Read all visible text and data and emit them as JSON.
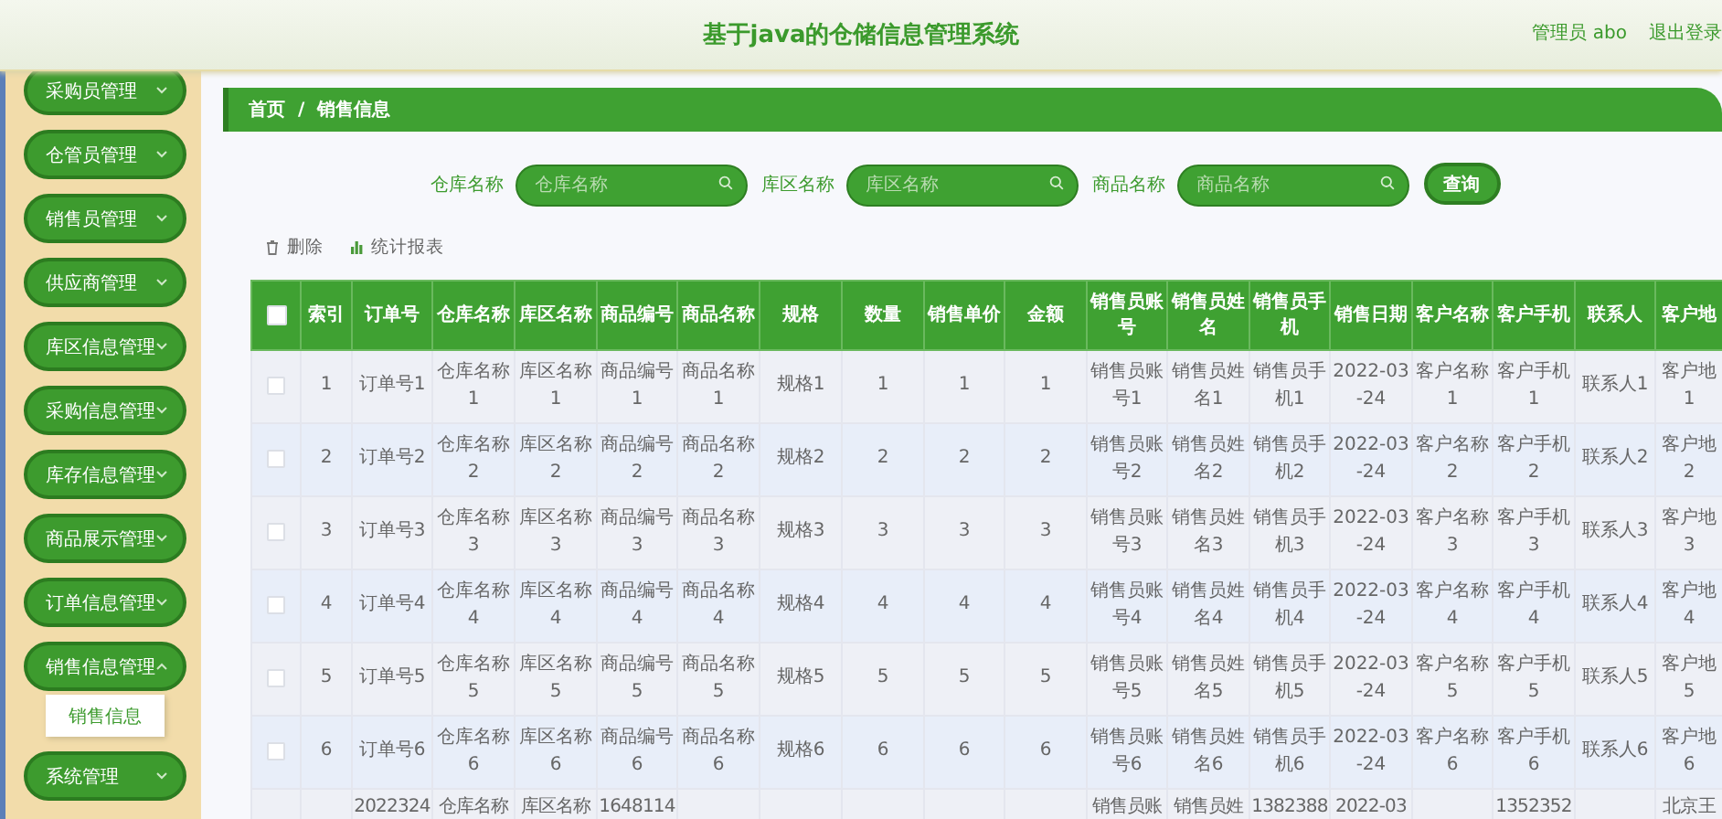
{
  "header": {
    "title": "基于java的仓储信息管理系统",
    "user": "管理员 abo",
    "logout": "退出登录"
  },
  "sidebar": {
    "items": [
      {
        "label": "采购员管理",
        "expanded": false
      },
      {
        "label": "仓管员管理",
        "expanded": false
      },
      {
        "label": "销售员管理",
        "expanded": false
      },
      {
        "label": "供应商管理",
        "expanded": false
      },
      {
        "label": "库区信息管理",
        "expanded": false
      },
      {
        "label": "采购信息管理",
        "expanded": false
      },
      {
        "label": "库存信息管理",
        "expanded": false
      },
      {
        "label": "商品展示管理",
        "expanded": false
      },
      {
        "label": "订单信息管理",
        "expanded": false
      },
      {
        "label": "销售信息管理",
        "expanded": true,
        "children": [
          {
            "label": "销售信息",
            "selected": true
          }
        ]
      },
      {
        "label": "系统管理",
        "expanded": false
      }
    ]
  },
  "breadcrumb": {
    "items": [
      "首页",
      "销售信息"
    ],
    "separator": "/"
  },
  "search": {
    "fields": [
      {
        "label": "仓库名称",
        "placeholder": "仓库名称"
      },
      {
        "label": "库区名称",
        "placeholder": "库区名称"
      },
      {
        "label": "商品名称",
        "placeholder": "商品名称"
      }
    ],
    "button": "查询"
  },
  "actions": [
    {
      "kind": "delete",
      "label": "删除"
    },
    {
      "kind": "chart",
      "label": "统计报表"
    }
  ],
  "table": {
    "all_checked": false,
    "columns": [
      "索引",
      "订单号",
      "仓库名称",
      "库区名称",
      "商品编号",
      "商品名称",
      "规格",
      "数量",
      "销售单价",
      "金额",
      "销售员账号",
      "销售员姓名",
      "销售员手机",
      "销售日期",
      "客户名称",
      "客户手机",
      "联系人",
      "客户地"
    ],
    "rows": [
      {
        "checked": false,
        "cells": [
          "1",
          "订单号1",
          "仓库名称1",
          "库区名称1",
          "商品编号1",
          "商品名称1",
          "规格1",
          "1",
          "1",
          "1",
          "销售员账号1",
          "销售员姓名1",
          "销售员手机1",
          "2022-03-24",
          "客户名称1",
          "客户手机1",
          "联系人1",
          "客户地1"
        ]
      },
      {
        "checked": false,
        "cells": [
          "2",
          "订单号2",
          "仓库名称2",
          "库区名称2",
          "商品编号2",
          "商品名称2",
          "规格2",
          "2",
          "2",
          "2",
          "销售员账号2",
          "销售员姓名2",
          "销售员手机2",
          "2022-03-24",
          "客户名称2",
          "客户手机2",
          "联系人2",
          "客户地2"
        ]
      },
      {
        "checked": false,
        "cells": [
          "3",
          "订单号3",
          "仓库名称3",
          "库区名称3",
          "商品编号3",
          "商品名称3",
          "规格3",
          "3",
          "3",
          "3",
          "销售员账号3",
          "销售员姓名3",
          "销售员手机3",
          "2022-03-24",
          "客户名称3",
          "客户手机3",
          "联系人3",
          "客户地3"
        ]
      },
      {
        "checked": false,
        "cells": [
          "4",
          "订单号4",
          "仓库名称4",
          "库区名称4",
          "商品编号4",
          "商品名称4",
          "规格4",
          "4",
          "4",
          "4",
          "销售员账号4",
          "销售员姓名4",
          "销售员手机4",
          "2022-03-24",
          "客户名称4",
          "客户手机4",
          "联系人4",
          "客户地4"
        ]
      },
      {
        "checked": false,
        "cells": [
          "5",
          "订单号5",
          "仓库名称5",
          "库区名称5",
          "商品编号5",
          "商品名称5",
          "规格5",
          "5",
          "5",
          "5",
          "销售员账号5",
          "销售员姓名5",
          "销售员手机5",
          "2022-03-24",
          "客户名称5",
          "客户手机5",
          "联系人5",
          "客户地5"
        ]
      },
      {
        "checked": false,
        "cells": [
          "6",
          "订单号6",
          "仓库名称6",
          "库区名称6",
          "商品编号6",
          "商品名称6",
          "规格6",
          "6",
          "6",
          "6",
          "销售员账号6",
          "销售员姓名6",
          "销售员手机6",
          "2022-03-24",
          "客户名称6",
          "客户手机6",
          "联系人6",
          "客户地6"
        ]
      },
      {
        "cells": [
          null,
          "2022324",
          "仓库名称",
          "库区名称",
          "1648114",
          null,
          null,
          null,
          null,
          null,
          "销售员账",
          "销售员姓",
          "1382388",
          "2022-03",
          null,
          "1352352",
          null,
          "北京王"
        ]
      }
    ]
  }
}
